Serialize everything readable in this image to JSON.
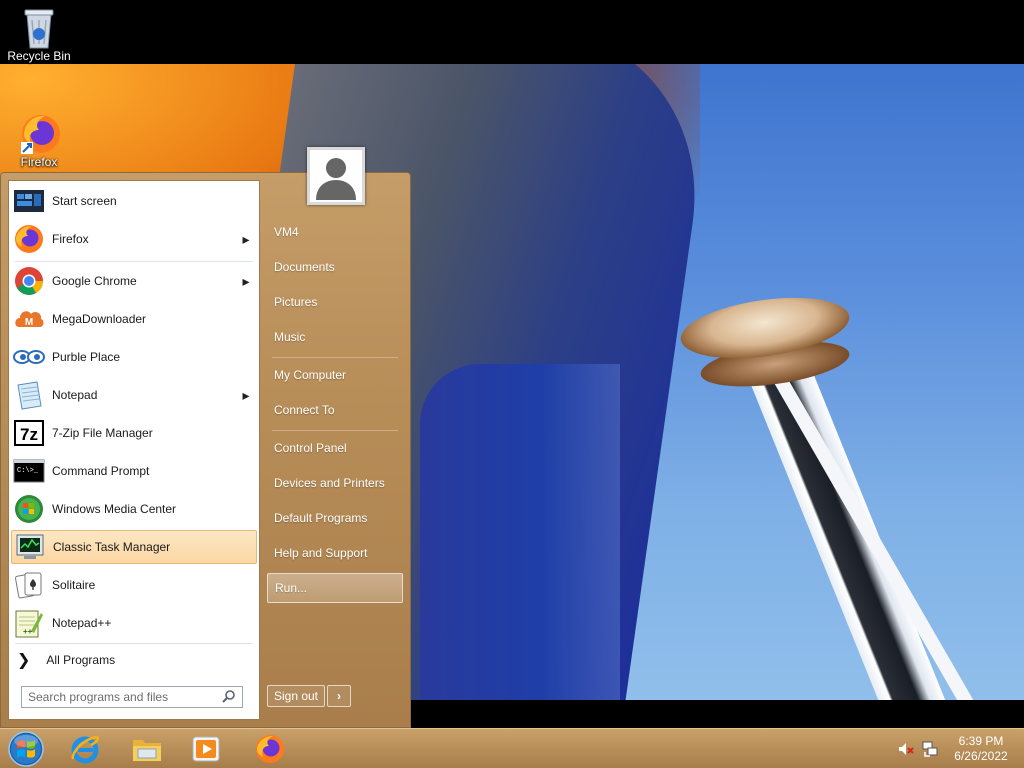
{
  "desktop": {
    "icons": [
      {
        "label": "Recycle Bin",
        "icon": "recycle-bin-icon"
      },
      {
        "label": "Firefox",
        "icon": "firefox-icon"
      }
    ]
  },
  "start_menu": {
    "programs": [
      {
        "label": "Start screen",
        "icon": "start-screen-icon",
        "submenu": false
      },
      {
        "label": "Firefox",
        "icon": "firefox-icon",
        "submenu": true
      },
      {
        "label": "Google Chrome",
        "icon": "chrome-icon",
        "submenu": true
      },
      {
        "label": "MegaDownloader",
        "icon": "megadownloader-icon",
        "submenu": false
      },
      {
        "label": "Purble Place",
        "icon": "purble-place-icon",
        "submenu": false
      },
      {
        "label": "Notepad",
        "icon": "notepad-icon",
        "submenu": true
      },
      {
        "label": "7-Zip File Manager",
        "icon": "7zip-icon",
        "submenu": false
      },
      {
        "label": "Command Prompt",
        "icon": "command-prompt-icon",
        "submenu": false
      },
      {
        "label": "Windows Media Center",
        "icon": "media-center-icon",
        "submenu": false
      },
      {
        "label": "Classic Task Manager",
        "icon": "task-manager-icon",
        "submenu": false,
        "highlighted": true
      },
      {
        "label": "Solitaire",
        "icon": "solitaire-icon",
        "submenu": false
      },
      {
        "label": "Notepad++",
        "icon": "notepadpp-icon",
        "submenu": false
      }
    ],
    "all_programs_label": "All Programs",
    "search_placeholder": "Search programs and files",
    "right_items": [
      {
        "label": "VM4"
      },
      {
        "label": "Documents"
      },
      {
        "label": "Pictures"
      },
      {
        "label": "Music"
      },
      {
        "label": "My Computer"
      },
      {
        "label": "Connect To"
      },
      {
        "label": "Control Panel"
      },
      {
        "label": "Devices and Printers"
      },
      {
        "label": "Default Programs"
      },
      {
        "label": "Help and Support"
      },
      {
        "label": "Run...",
        "hover": true
      }
    ],
    "signout_label": "Sign out",
    "signout_arrow": "›"
  },
  "taskbar": {
    "pinned": [
      "internet-explorer-icon",
      "file-explorer-icon",
      "media-player-icon",
      "firefox-icon"
    ],
    "tray": [
      "volume-muted-icon",
      "network-icon"
    ],
    "time": "6:39 PM",
    "date": "6/26/2022"
  }
}
